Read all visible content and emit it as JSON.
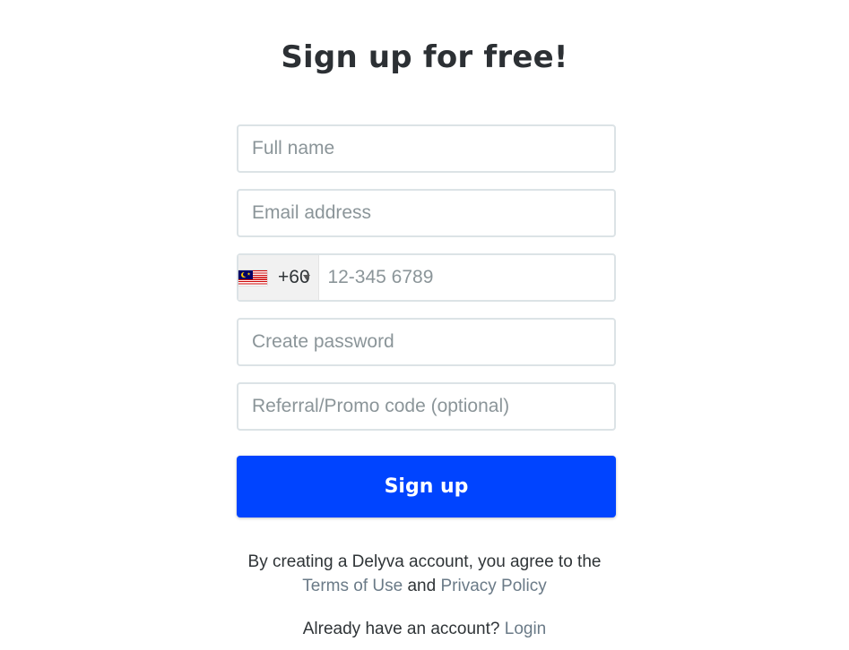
{
  "page": {
    "title": "Sign up for free!"
  },
  "form": {
    "full_name_placeholder": "Full name",
    "email_placeholder": "Email address",
    "phone": {
      "country_flag": "malaysia-flag",
      "dial_code": "+60",
      "placeholder": "12-345 6789"
    },
    "password_placeholder": "Create password",
    "promo_placeholder": "Referral/Promo code (optional)",
    "submit_label": "Sign up"
  },
  "agreement": {
    "prefix": "By creating a Delyva account, you agree to the",
    "terms_link": "Terms of Use",
    "conjunction": "and",
    "privacy_link": "Privacy Policy"
  },
  "login": {
    "prompt": "Already have an account?",
    "link": "Login"
  },
  "colors": {
    "accent": "#0044ff",
    "link": "#6a7a87",
    "field_border": "#dce3e6",
    "placeholder": "#8b9599"
  }
}
